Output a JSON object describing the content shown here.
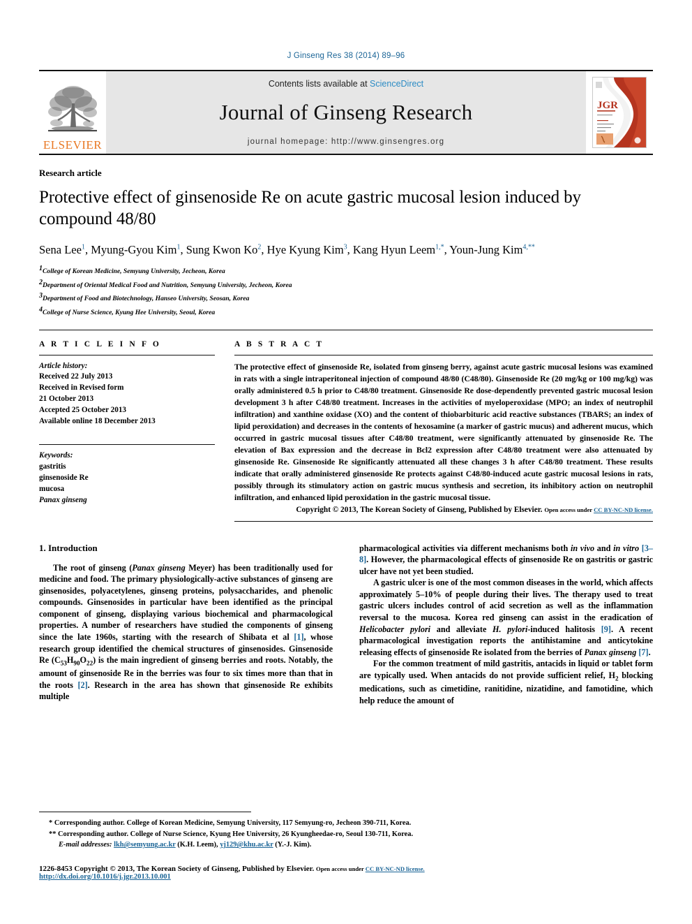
{
  "running_head": "J Ginseng Res 38 (2014) 89–96",
  "masthead": {
    "publisher_name": "ELSEVIER",
    "contents_prefix": "Contents lists available at ",
    "contents_link": "ScienceDirect",
    "journal_title": "Journal of Ginseng Research",
    "homepage": "journal homepage: http://www.ginsengres.org",
    "cover_label": "JGR"
  },
  "article": {
    "kicker": "Research article",
    "title": "Protective effect of ginsenoside Re on acute gastric mucosal lesion induced by compound 48/80",
    "authors": [
      {
        "name": "Sena Lee",
        "marks": "1"
      },
      {
        "name": "Myung-Gyou Kim",
        "marks": "1"
      },
      {
        "name": "Sung Kwon Ko",
        "marks": "2"
      },
      {
        "name": "Hye Kyung Kim",
        "marks": "3"
      },
      {
        "name": "Kang Hyun Leem",
        "marks": "1,*"
      },
      {
        "name": "Youn-Jung Kim",
        "marks": "4,**"
      }
    ],
    "affiliations": [
      {
        "num": "1",
        "text": "College of Korean Medicine, Semyung University, Jecheon, Korea"
      },
      {
        "num": "2",
        "text": "Department of Oriental Medical Food and Nutrition, Semyung University, Jecheon, Korea"
      },
      {
        "num": "3",
        "text": "Department of Food and Biotechnology, Hanseo University, Seosan, Korea"
      },
      {
        "num": "4",
        "text": "College of Nurse Science, Kyung Hee University, Seoul, Korea"
      }
    ]
  },
  "article_info": {
    "heading": "A R T I C L E   I N F O",
    "history_label": "Article history:",
    "history": [
      "Received 22 July 2013",
      "Received in Revised form",
      "21 October 2013",
      "Accepted 25 October 2013",
      "Available online 18 December 2013"
    ],
    "keywords_label": "Keywords:",
    "keywords": [
      "gastritis",
      "ginsenoside Re",
      "mucosa",
      "Panax ginseng"
    ],
    "keyword_italic_index": 3
  },
  "abstract": {
    "heading": "A B S T R A C T",
    "text": "The protective effect of ginsenoside Re, isolated from ginseng berry, against acute gastric mucosal lesions was examined in rats with a single intraperitoneal injection of compound 48/80 (C48/80). Ginsenoside Re (20 mg/kg or 100 mg/kg) was orally administered 0.5 h prior to C48/80 treatment. Ginsenoside Re dose-dependently prevented gastric mucosal lesion development 3 h after C48/80 treatment. Increases in the activities of myeloperoxidase (MPO; an index of neutrophil infiltration) and xanthine oxidase (XO) and the content of thiobarbituric acid reactive substances (TBARS; an index of lipid peroxidation) and decreases in the contents of hexosamine (a marker of gastric mucus) and adherent mucus, which occurred in gastric mucosal tissues after C48/80 treatment, were significantly attenuated by ginsenoside Re. The elevation of Bax expression and the decrease in Bcl2 expression after C48/80 treatment were also attenuated by ginsenoside Re. Ginsenoside Re significantly attenuated all these changes 3 h after C48/80 treatment. These results indicate that orally administered ginsenoside Re protects against C48/80-induced acute gastric mucosal lesions in rats, possibly through its stimulatory action on gastric mucus synthesis and secretion, its inhibitory action on neutrophil infiltration, and enhanced lipid peroxidation in the gastric mucosal tissue.",
    "copyright": "Copyright © 2013, The Korean Society of Ginseng, Published by Elsevier.",
    "open_access_prefix": "Open access under ",
    "open_access_link": "CC BY-NC-ND license."
  },
  "introduction": {
    "heading": "1.  Introduction",
    "left_paragraphs": [
      {
        "parts": [
          {
            "t": "The root of ginseng ("
          },
          {
            "t": "Panax ginseng",
            "s": "i"
          },
          {
            "t": " Meyer) has been traditionally used for medicine and food. The primary physiologically-active substances of ginseng are ginsenosides, polyacetylenes, ginseng proteins, polysaccharides, and phenolic compounds. Ginsenosides in particular have been identified as the principal component of ginseng, displaying various biochemical and pharmacological properties. A number of researchers have studied the components of ginseng since the late 1960s, starting with the research of Shibata et al "
          },
          {
            "t": "[1]",
            "s": "ref"
          },
          {
            "t": ", whose research group identified the chemical structures of ginsenosides. Ginsenoside Re (C"
          },
          {
            "t": "53",
            "s": "sub"
          },
          {
            "t": "H"
          },
          {
            "t": "90",
            "s": "sub"
          },
          {
            "t": "O"
          },
          {
            "t": "22",
            "s": "sub"
          },
          {
            "t": ") is the main ingredient of ginseng berries and roots. Notably, the amount of ginsenoside Re in the berries was four to six times more than that in the roots "
          },
          {
            "t": "[2]",
            "s": "ref"
          },
          {
            "t": ". Research in the area has shown that ginsenoside Re exhibits multiple"
          }
        ]
      }
    ],
    "right_paragraphs": [
      {
        "indent": false,
        "parts": [
          {
            "t": "pharmacological activities via different mechanisms both "
          },
          {
            "t": "in vivo",
            "s": "i"
          },
          {
            "t": " and "
          },
          {
            "t": "in vitro",
            "s": "i"
          },
          {
            "t": " "
          },
          {
            "t": "[3–8]",
            "s": "ref"
          },
          {
            "t": ". However, the pharmacological effects of ginsenoside Re on gastritis or gastric ulcer have not yet been studied."
          }
        ]
      },
      {
        "indent": true,
        "parts": [
          {
            "t": "A gastric ulcer is one of the most common diseases in the world, which affects approximately 5–10% of people during their lives. The therapy used to treat gastric ulcers includes control of acid secretion as well as the inflammation reversal to the mucosa. Korea red ginseng can assist in the eradication of "
          },
          {
            "t": "Helicobacter pylori",
            "s": "i"
          },
          {
            "t": " and alleviate "
          },
          {
            "t": "H. pylori",
            "s": "i"
          },
          {
            "t": "-induced halitosis "
          },
          {
            "t": "[9]",
            "s": "ref"
          },
          {
            "t": ". A recent pharmacological investigation reports the antihistamine and anticytokine releasing effects of ginsenoside Re isolated from the berries of "
          },
          {
            "t": "Panax ginseng",
            "s": "i"
          },
          {
            "t": " "
          },
          {
            "t": "[7]",
            "s": "ref"
          },
          {
            "t": "."
          }
        ]
      },
      {
        "indent": true,
        "parts": [
          {
            "t": "For the common treatment of mild gastritis, antacids in liquid or tablet form are typically used. When antacids do not provide sufficient relief, H"
          },
          {
            "t": "2",
            "s": "sub"
          },
          {
            "t": " blocking medications, such as cimetidine, ranitidine, nizatidine, and famotidine, which help reduce the amount of"
          }
        ]
      }
    ]
  },
  "footer": {
    "corresponding_1_mark": "*",
    "corresponding_1": "Corresponding author. College of Korean Medicine, Semyung University, 117 Semyung-ro, Jecheon 390-711, Korea.",
    "corresponding_2_mark": "**",
    "corresponding_2": "Corresponding author. College of Nurse Science, Kyung Hee University, 26 Kyungheedae-ro, Seoul 130-711, Korea.",
    "email_label": "E-mail addresses:",
    "email_1": "lkh@semyung.ac.kr",
    "email_1_owner": "(K.H. Leem),",
    "email_2": "yj129@khu.ac.kr",
    "email_2_owner": "(Y.-J. Kim).",
    "issn_line": "1226-8453 Copyright © 2013, The Korean Society of Ginseng, Published by Elsevier.",
    "issn_oa_prefix": "Open access under ",
    "issn_oa_link": "CC BY-NC-ND license.",
    "doi": "http://dx.doi.org/10.1016/j.jgr.2013.10.001"
  },
  "colors": {
    "link_blue": "#1a6496",
    "sciencedirect_blue": "#2b8bc4",
    "elsevier_orange": "#e87722",
    "masthead_gray": "#e6e6e6"
  }
}
